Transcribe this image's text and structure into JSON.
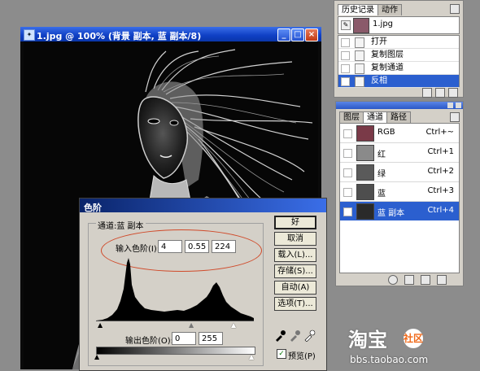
{
  "image_window": {
    "title": "1.jpg @ 100% (背景 副本, 蓝 副本/8)",
    "icon": "document-icon",
    "buttons": [
      "minimize",
      "maximize",
      "close"
    ]
  },
  "history_panel": {
    "tabs": [
      "历史记录",
      "动作"
    ],
    "snapshot_name": "1.jpg",
    "items": [
      {
        "label": "打开",
        "selected": false
      },
      {
        "label": "复制图层",
        "selected": false
      },
      {
        "label": "复制通道",
        "selected": false
      },
      {
        "label": "反相",
        "selected": true
      }
    ]
  },
  "channels_panel": {
    "tabs": [
      "图层",
      "通道",
      "路径"
    ],
    "channels": [
      {
        "name": "RGB",
        "shortcut": "Ctrl+~",
        "selected": false
      },
      {
        "name": "红",
        "shortcut": "Ctrl+1",
        "selected": false
      },
      {
        "name": "绿",
        "shortcut": "Ctrl+2",
        "selected": false
      },
      {
        "name": "蓝",
        "shortcut": "Ctrl+3",
        "selected": false
      },
      {
        "name": "蓝 副本",
        "shortcut": "Ctrl+4",
        "selected": true
      }
    ]
  },
  "levels_dialog": {
    "title": "色阶",
    "channel_label": "通道:蓝 副本",
    "input_label": "输入色阶(I):",
    "input_values": [
      "4",
      "0.55",
      "224"
    ],
    "output_label": "输出色阶(O):",
    "output_values": [
      "0",
      "255"
    ],
    "buttons": {
      "ok": "好",
      "cancel": "取消",
      "load": "载入(L)...",
      "save": "存储(S)...",
      "auto": "自动(A)",
      "options": "选项(T)..."
    },
    "preview_label": "预览(P)",
    "preview_checked": true
  },
  "watermark": {
    "brand": "淘宝",
    "community": "社区",
    "url": "bbs.taobao.com"
  },
  "colors": {
    "xp_title": "#0f3fc4",
    "selection": "#2b5fcf",
    "highlight_ellipse": "#d04a2a"
  }
}
